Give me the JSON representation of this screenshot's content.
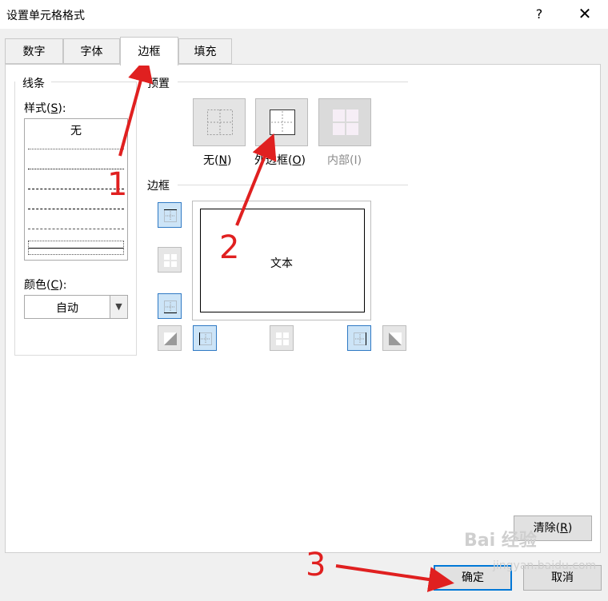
{
  "window": {
    "title": "设置单元格格式",
    "help_label": "?",
    "close_label": "✕"
  },
  "tabs": [
    {
      "label": "数字",
      "active": false
    },
    {
      "label": "字体",
      "active": false
    },
    {
      "label": "边框",
      "active": true
    },
    {
      "label": "填充",
      "active": false
    }
  ],
  "line_group": {
    "title": "线条",
    "style_label": "样式(",
    "style_key": "S",
    "style_suffix": "):",
    "none_label": "无",
    "color_label": "颜色(",
    "color_key": "C",
    "color_suffix": "):",
    "color_value": "自动"
  },
  "presets_group": {
    "title": "预置",
    "none": {
      "label": "无(",
      "key": "N",
      "suffix": ")"
    },
    "outline": {
      "label": "外边框(",
      "key": "O",
      "suffix": ")"
    },
    "inside": {
      "label": "内部(I)"
    }
  },
  "border_group": {
    "title": "边框",
    "preview_text": "文本"
  },
  "buttons": {
    "clear_label": "清除(",
    "clear_key": "R",
    "clear_suffix": ")",
    "ok_label": "确定",
    "cancel_label": "取消"
  },
  "annotations": {
    "step1": "1",
    "step2": "2",
    "step3": "3"
  },
  "watermark": {
    "brand": "Bai 经验",
    "url": "jingyan.baidu.com"
  },
  "colors": {
    "selected_border": "#2f79c4",
    "selected_fill": "#cce4f7",
    "primary_focus": "#0078d7",
    "annotation": "#e02020"
  }
}
